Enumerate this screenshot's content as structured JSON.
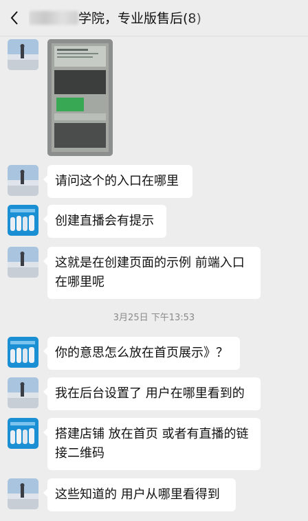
{
  "header": {
    "title_visible": "学院，专业版售后(8)",
    "back_icon": "chevron-left-icon"
  },
  "avatars": {
    "user_a": "avatar-person-snow",
    "user_b": "avatar-blue-group"
  },
  "messages": [
    {
      "sender": "user_a",
      "type": "image"
    },
    {
      "sender": "user_a",
      "type": "text",
      "text": "请问这个的入口在哪里"
    },
    {
      "sender": "user_b",
      "type": "text",
      "text": "创建直播会有提示"
    },
    {
      "sender": "user_a",
      "type": "text",
      "text": "这就是在创建页面的示例 前端入口在哪里呢"
    },
    {
      "sender": "user_b",
      "type": "text",
      "text": "你的意思怎么放在首页展示》？"
    },
    {
      "sender": "user_a",
      "type": "text",
      "text": "我在后台设置了 用户在哪里看到的"
    },
    {
      "sender": "user_b",
      "type": "text",
      "text": "搭建店铺 放在首页  或者有直播的链接二维码"
    },
    {
      "sender": "user_a",
      "type": "text",
      "text": "这些知道的 用户从哪里看得到"
    }
  ],
  "timestamp": "3月25日 下午13:53",
  "colors": {
    "background": "#ededed",
    "bubble": "#ffffff",
    "text": "#111111",
    "timestamp": "#8a8a8a"
  }
}
